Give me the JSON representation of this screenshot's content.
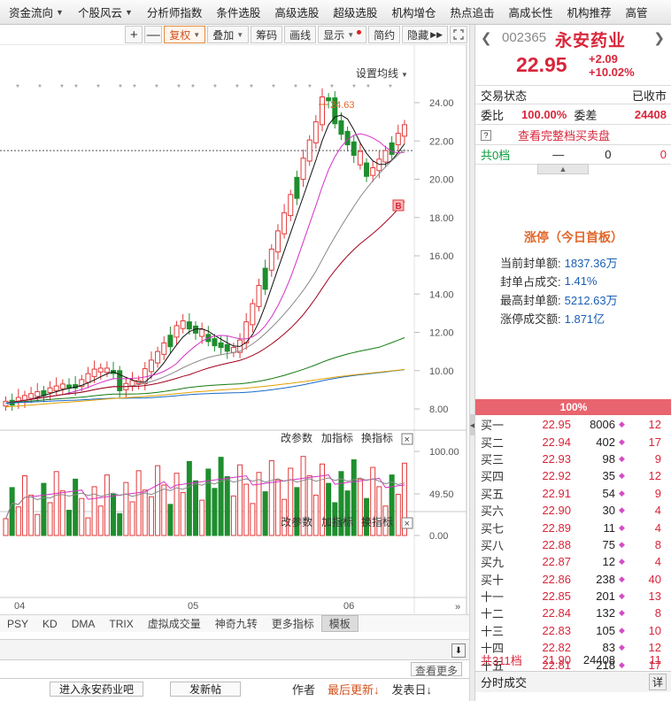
{
  "topnav": [
    {
      "label": "资金流向",
      "caret": true
    },
    {
      "label": "个股风云",
      "caret": true
    },
    {
      "label": "分析师指数",
      "caret": false
    },
    {
      "label": "条件选股",
      "caret": false
    },
    {
      "label": "高级选股",
      "caret": false
    },
    {
      "label": "超级选股",
      "caret": false
    },
    {
      "label": "机构增仓",
      "caret": false
    },
    {
      "label": "热点追击",
      "caret": false
    },
    {
      "label": "高成长性",
      "caret": false
    },
    {
      "label": "机构推荐",
      "caret": false
    },
    {
      "label": "高管",
      "caret": false
    }
  ],
  "toolbar": {
    "plus": "+",
    "minus": "—",
    "fuquan": "复权",
    "diejia": "叠加",
    "chouma": "筹码",
    "huaxian": "画线",
    "xianshi": "显示",
    "jianyue": "简约",
    "yincang": "隐藏",
    "expand_icon": "expand-icon"
  },
  "chart": {
    "ma_settings": "设置均线",
    "high_marker": "24.63",
    "b_marker": "B",
    "y_ticks": [
      "24.00",
      "22.00",
      "20.00",
      "18.00",
      "16.00",
      "14.00",
      "12.00",
      "10.00",
      "8.00"
    ],
    "indicator_panel": {
      "change_params": "改参数",
      "add_indicator": "加指标",
      "switch_indicator": "换指标",
      "y_ticks": [
        "100.00",
        "49.50",
        "0.00"
      ]
    },
    "panel3": {
      "change_params": "改参数",
      "add_indicator": "加指标",
      "switch_indicator": "换指标"
    },
    "x_labels": [
      "04",
      "05",
      "06"
    ],
    "colors": {
      "up": "#e23a3a",
      "down": "#1f8e2e",
      "ma5": "#111111",
      "ma10": "#d530c6",
      "ma20": "#888888",
      "ma30": "#a3001c",
      "ma60": "#137a13",
      "ma120": "#1769c8",
      "ma250": "#e0a000"
    }
  },
  "bottom_tabs": [
    "PSY",
    "KD",
    "DMA",
    "TRIX",
    "虚拟成交量",
    "神奇九转",
    "更多指标",
    "模板"
  ],
  "forum": {
    "see_more": "查看更多",
    "go_forum": "进入永安药业吧",
    "new_post": "发新帖",
    "author": "作者",
    "last_update": "最后更新↓",
    "post_date": "发表日↓"
  },
  "stock": {
    "code": "002365",
    "name": "永安药业",
    "price": "22.95",
    "change": "+2.09",
    "change_pct": "+10.02%",
    "trade_status_label": "交易状态",
    "trade_status": "已收市",
    "weibi_label": "委比",
    "weibi": "100.00%",
    "weicha_label": "委差",
    "weicha": "24408",
    "full_orderbook": "查看完整档买卖盘",
    "sell_total_label": "共0档",
    "sell_total_dash": "—",
    "sell_total_vol": "0",
    "sell_total_cnt": "0"
  },
  "limit_up": {
    "title": "涨停（今日首板）",
    "items": [
      {
        "label": "当前封单额:",
        "value": "1837.36万"
      },
      {
        "label": "封单占成交:",
        "value": "1.41%"
      },
      {
        "label": "最高封单额:",
        "value": "5212.63万"
      },
      {
        "label": "涨停成交额:",
        "value": "1.871亿"
      }
    ]
  },
  "pct_bar": "100%",
  "bids": [
    {
      "label": "买一",
      "price": "22.95",
      "vol": "8006",
      "cnt": "12"
    },
    {
      "label": "买二",
      "price": "22.94",
      "vol": "402",
      "cnt": "17"
    },
    {
      "label": "买三",
      "price": "22.93",
      "vol": "98",
      "cnt": "9"
    },
    {
      "label": "买四",
      "price": "22.92",
      "vol": "35",
      "cnt": "12"
    },
    {
      "label": "买五",
      "price": "22.91",
      "vol": "54",
      "cnt": "9"
    },
    {
      "label": "买六",
      "price": "22.90",
      "vol": "30",
      "cnt": "4"
    },
    {
      "label": "买七",
      "price": "22.89",
      "vol": "11",
      "cnt": "4"
    },
    {
      "label": "买八",
      "price": "22.88",
      "vol": "75",
      "cnt": "8"
    },
    {
      "label": "买九",
      "price": "22.87",
      "vol": "12",
      "cnt": "4"
    },
    {
      "label": "买十",
      "price": "22.86",
      "vol": "238",
      "cnt": "40"
    },
    {
      "label": "十一",
      "price": "22.85",
      "vol": "201",
      "cnt": "13"
    },
    {
      "label": "十二",
      "price": "22.84",
      "vol": "132",
      "cnt": "8"
    },
    {
      "label": "十三",
      "price": "22.83",
      "vol": "105",
      "cnt": "10"
    },
    {
      "label": "十四",
      "price": "22.82",
      "vol": "83",
      "cnt": "12"
    },
    {
      "label": "十五",
      "price": "22.81",
      "vol": "218",
      "cnt": "17"
    }
  ],
  "bid_total": {
    "label": "共311档",
    "price": "21.90",
    "vol": "24408",
    "cnt": "11"
  },
  "fenshi": {
    "label": "分时成交",
    "detail": "详"
  }
}
